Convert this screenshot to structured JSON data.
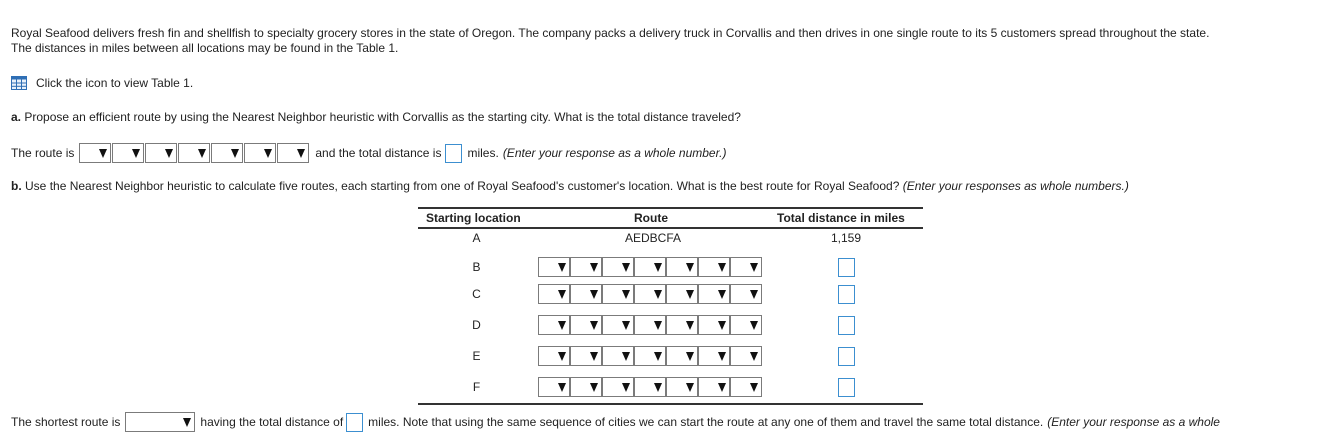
{
  "intro": {
    "line1": "Royal Seafood delivers fresh fin and shellfish to specialty grocery stores in the state of Oregon. The company packs a delivery truck in Corvallis and then drives in one single route to its 5 customers spread throughout the state.",
    "line2": "The distances in miles between all locations may be found in the Table 1."
  },
  "table_link": {
    "icon": "table-icon",
    "text": "Click the icon to view Table 1."
  },
  "part_a": {
    "label": "a.",
    "question": "Propose an efficient route by using the Nearest Neighbor heuristic with Corvallis as the starting city. What is the total distance traveled?",
    "route_prefix": "The route is",
    "distance_prefix": "and the total distance is",
    "miles": "miles.",
    "instruction": "(Enter your response as a whole number.)"
  },
  "part_b": {
    "label": "b.",
    "question": "Use the Nearest Neighbor heuristic to calculate five routes, each starting from one of Royal Seafood's customer's location. What is the best route for Royal Seafood?",
    "instruction": "(Enter your responses as whole numbers.)",
    "table": {
      "headers": {
        "start": "Starting location",
        "route": "Route",
        "total": "Total distance in miles"
      },
      "given_row": {
        "start": "A",
        "route": "AEDBCFA",
        "total": "1,159"
      },
      "rows": [
        "B",
        "C",
        "D",
        "E",
        "F"
      ]
    }
  },
  "bottom": {
    "prefix": "The shortest route is",
    "middle": "having the total distance of",
    "suffix": "miles. Note that using the same sequence of cities we can start the route at any one of them and travel the same total distance.",
    "instruction": "(Enter your response as a whole"
  }
}
